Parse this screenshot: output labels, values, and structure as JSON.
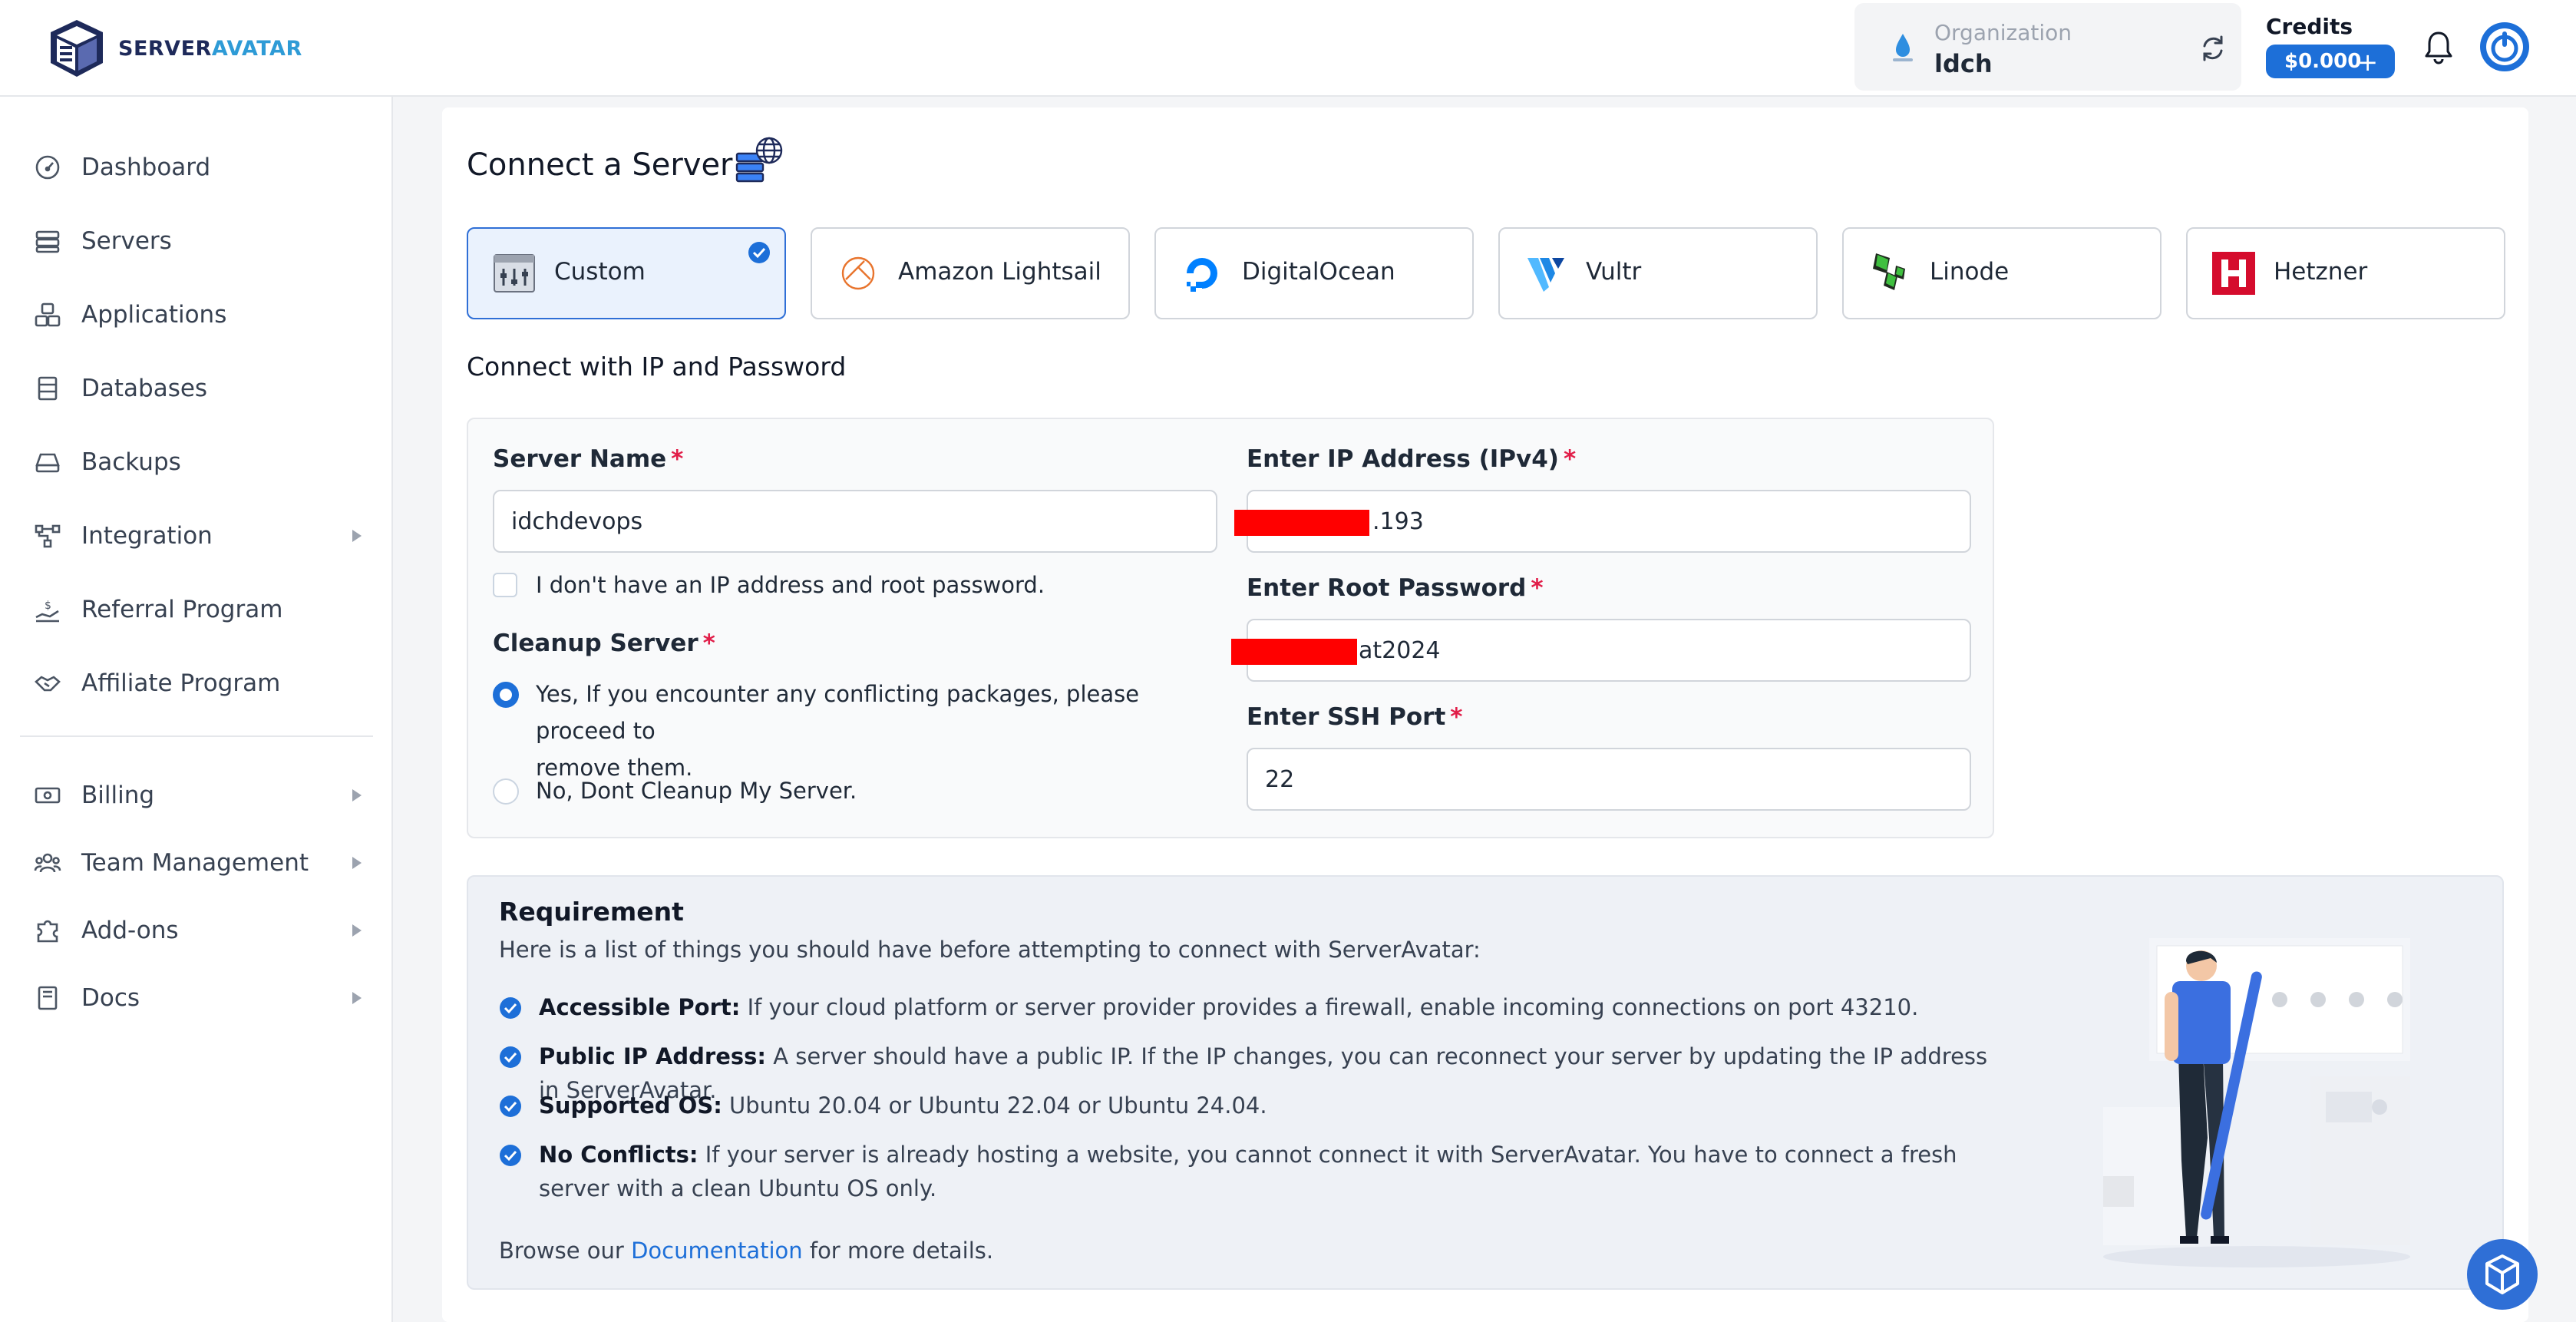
{
  "brand": {
    "name_part1": "SERVER",
    "name_part2": "AVATAR"
  },
  "topbar": {
    "org_label": "Organization",
    "org_name": "ldch",
    "credits_label": "Credits",
    "credits_value": "$0.000",
    "credits_plus": "+"
  },
  "sidebar": {
    "items": [
      {
        "label": "Dashboard",
        "icon": "gauge-icon"
      },
      {
        "label": "Servers",
        "icon": "server-icon"
      },
      {
        "label": "Applications",
        "icon": "cubes-icon"
      },
      {
        "label": "Databases",
        "icon": "database-icon"
      },
      {
        "label": "Backups",
        "icon": "drive-icon"
      },
      {
        "label": "Integration",
        "icon": "integration-icon",
        "has_caret": true
      },
      {
        "label": "Referral Program",
        "icon": "referral-icon"
      },
      {
        "label": "Affiliate Program",
        "icon": "handshake-icon"
      },
      {
        "label": "Billing",
        "icon": "billing-icon",
        "has_caret": true
      },
      {
        "label": "Team Management",
        "icon": "team-icon",
        "has_caret": true
      },
      {
        "label": "Add-ons",
        "icon": "puzzle-icon",
        "has_caret": true
      },
      {
        "label": "Docs",
        "icon": "book-icon",
        "has_caret": true
      }
    ]
  },
  "main": {
    "title": "Connect a Server",
    "providers": [
      {
        "label": "Custom",
        "icon": "custom-server-icon",
        "selected": true
      },
      {
        "label": "Amazon Lightsail",
        "icon": "lightsail-icon"
      },
      {
        "label": "DigitalOcean",
        "icon": "digitalocean-icon"
      },
      {
        "label": "Vultr",
        "icon": "vultr-icon"
      },
      {
        "label": "Linode",
        "icon": "linode-icon"
      },
      {
        "label": "Hetzner",
        "icon": "hetzner-icon"
      }
    ],
    "subheading": "Connect with IP and Password",
    "form": {
      "server_name_label": "Server Name",
      "server_name_value": "idchdevops",
      "no_ip_label": "I don't have an IP address and root password.",
      "cleanup_label": "Cleanup Server",
      "cleanup_yes_line1": "Yes, If you encounter any conflicting packages, please proceed to",
      "cleanup_yes_line2": "remove them.",
      "cleanup_no": "No, Dont Cleanup My Server.",
      "ip_label": "Enter IP Address (IPv4)",
      "ip_value_visible": ".193",
      "password_label": "Enter Root Password",
      "password_value_visible": "at2024",
      "ssh_label": "Enter SSH Port",
      "ssh_value": "22",
      "required_mark": "*"
    },
    "requirement": {
      "title": "Requirement",
      "intro": "Here is a list of things you should have before attempting to connect with ServerAvatar:",
      "items": [
        {
          "bold": "Accessible Port:",
          "text": " If your cloud platform or server provider provides a firewall, enable incoming connections on port 43210."
        },
        {
          "bold": "Public IP Address:",
          "text": " A server should have a public IP. If the IP changes, you can reconnect your server by updating the IP address in ServerAvatar."
        },
        {
          "bold": "Supported OS:",
          "text": " Ubuntu 20.04 or Ubuntu 22.04 or Ubuntu 24.04."
        },
        {
          "bold": "No Conflicts:",
          "text": " If your server is already hosting a website, you cannot connect it with ServerAvatar. You have to connect a fresh server with a clean Ubuntu OS only."
        }
      ],
      "footer_prefix": "Browse our ",
      "footer_link": "Documentation",
      "footer_suffix": " for more details."
    }
  },
  "colors": {
    "accent": "#1d6fd8",
    "required": "#e11d48",
    "redaction": "#ff0000"
  }
}
